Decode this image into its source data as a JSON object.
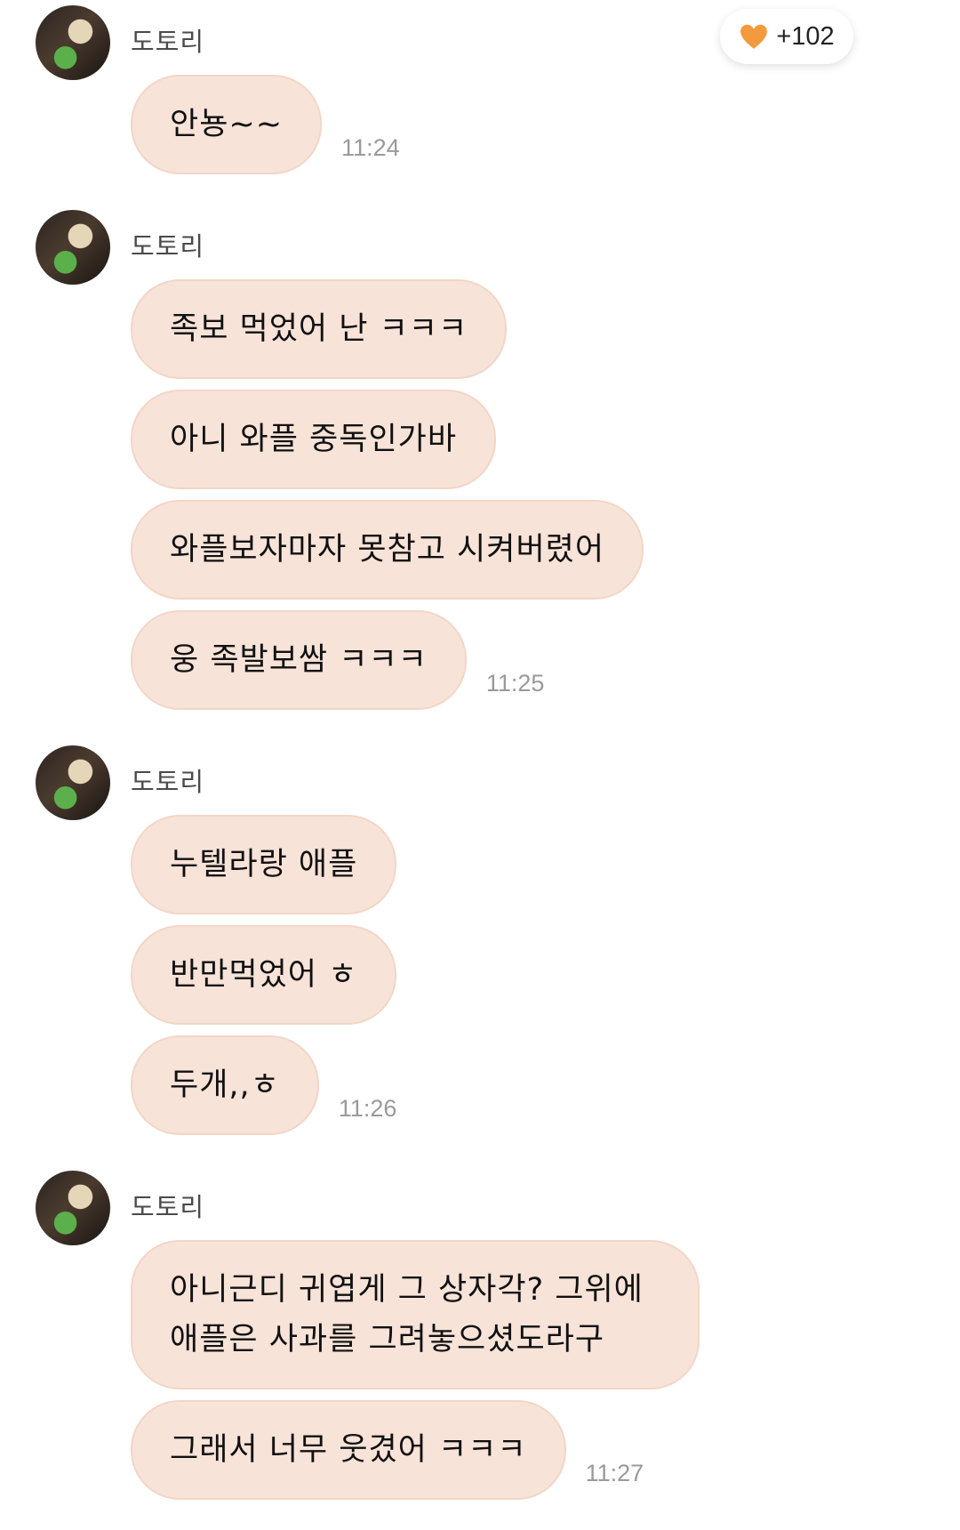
{
  "badge": {
    "icon": "heart-icon",
    "color": "#f39a3c",
    "count": "+102"
  },
  "groups": [
    {
      "sender": "도토리",
      "messages": [
        {
          "text": "안뇽~~",
          "time": "11:24"
        }
      ]
    },
    {
      "sender": "도토리",
      "messages": [
        {
          "text": "족보 먹었어 난 ㅋㅋㅋ",
          "time": ""
        },
        {
          "text": "아니 와플 중독인가바",
          "time": ""
        },
        {
          "text": "와플보자마자 못참고 시켜버렸어",
          "time": ""
        },
        {
          "text": "웅 족발보쌈 ㅋㅋㅋ",
          "time": "11:25"
        }
      ]
    },
    {
      "sender": "도토리",
      "messages": [
        {
          "text": "누텔라랑 애플",
          "time": ""
        },
        {
          "text": "반만먹었어 ㅎ",
          "time": ""
        },
        {
          "text": "두개,,ㅎ",
          "time": "11:26"
        }
      ]
    },
    {
      "sender": "도토리",
      "messages": [
        {
          "text": "아니근디 귀엽게 그 상자각? 그위에 애플은 사과를 그려놓으셨도라구",
          "time": ""
        },
        {
          "text": "그래서 너무 웃겼어 ㅋㅋㅋ",
          "time": "11:27"
        }
      ]
    }
  ]
}
